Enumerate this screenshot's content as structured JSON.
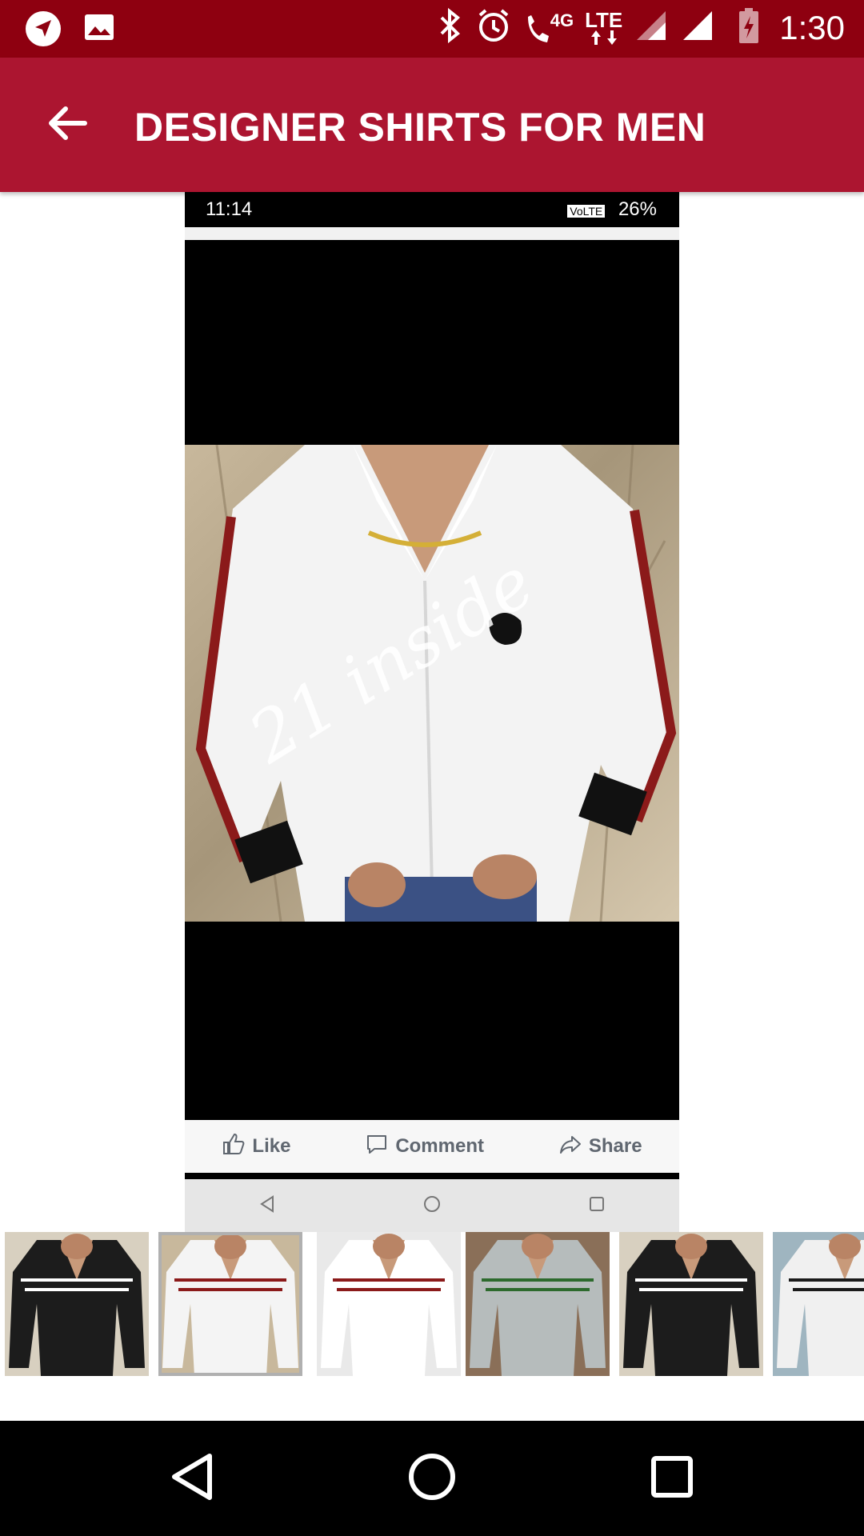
{
  "status_bar": {
    "time": "1:30",
    "network_4g": "4G",
    "lte": "LTE",
    "icons": [
      "navigation-icon",
      "image-icon",
      "bluetooth-icon",
      "alarm-icon",
      "wifi-calling-icon",
      "signal-icon",
      "battery-charging-icon"
    ]
  },
  "app_bar": {
    "title": "DESIGNER SHIRTS FOR MEN",
    "back_icon": "arrow-back-icon"
  },
  "main_image": {
    "inner_time": "11:14",
    "inner_volte": "VoLTE",
    "inner_battery": "26%",
    "watermark": "21 inside",
    "like_label": "Like",
    "comment_label": "Comment",
    "share_label": "Share"
  },
  "thumbnails": [
    {
      "shirt": "#1c1c1c",
      "accent": "#ffffff",
      "bg": "#d8d0c0",
      "selected": false
    },
    {
      "shirt": "#f4f4f4",
      "accent": "#8b1a1a",
      "bg": "#c8b89c",
      "selected": true
    },
    {
      "shirt": "#ffffff",
      "accent": "#8b1a1a",
      "bg": "#e9e9e9",
      "selected": false
    },
    {
      "shirt": "#b6bcbc",
      "accent": "#2d6a2d",
      "bg": "#8a6f58",
      "selected": false
    },
    {
      "shirt": "#1c1c1c",
      "accent": "#ffffff",
      "bg": "#d8d0c0",
      "selected": false
    },
    {
      "shirt": "#f0f0f0",
      "accent": "#1a1a1a",
      "bg": "#9fb5c0",
      "selected": false
    }
  ],
  "colors": {
    "status_bar": "#8e0010",
    "app_bar": "#ac1530"
  }
}
